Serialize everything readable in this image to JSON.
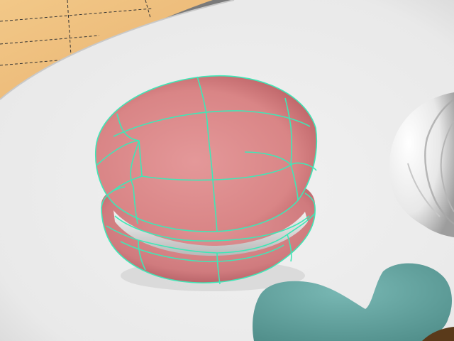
{
  "viewport": {
    "background_color": "#7e7e7e",
    "plate_color": "#eeeeee",
    "board_color": "#f0c487",
    "macaron_color": "#df8f8f",
    "macaron_shadow_color": "#b55e62",
    "filling_color": "#e7e7e7",
    "wireframe_color": "#3fe7b6",
    "cream_color": "#f1f1f1",
    "teal_blob_color": "#6aa9a5",
    "wood_color": "#5a3a1a",
    "objects": [
      {
        "name": "cutting-board",
        "selected": false
      },
      {
        "name": "plate",
        "selected": false
      },
      {
        "name": "macaron",
        "selected": true
      },
      {
        "name": "whipped-cream",
        "selected": false
      },
      {
        "name": "teal-blob",
        "selected": false
      }
    ]
  }
}
